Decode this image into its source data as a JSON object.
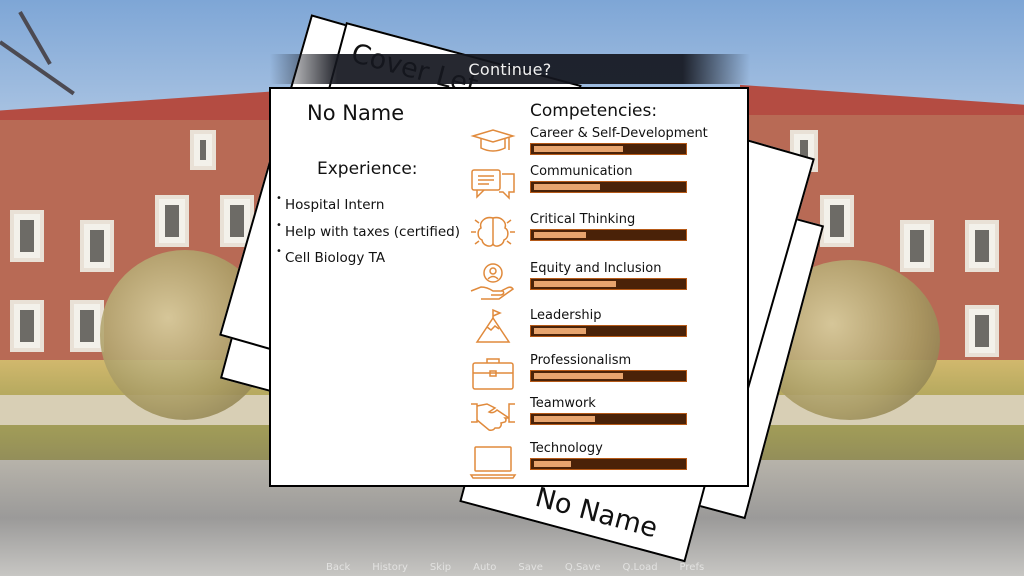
{
  "banner": {
    "continue_label": "Continue?"
  },
  "papers": {
    "cover_letter_title": "Cover Let",
    "bottom_name": "No Name"
  },
  "resume": {
    "name": "No Name",
    "experience_title": "Experience:",
    "experience": [
      "Hospital Intern",
      "Help with taxes (certified)",
      "Cell Biology TA"
    ],
    "competencies_title": "Competencies:",
    "competencies": [
      {
        "label": "Career & Self-Development",
        "icon": "graduation-cap-icon",
        "level": 0.6
      },
      {
        "label": "Communication",
        "icon": "speech-bubbles-icon",
        "level": 0.44
      },
      {
        "label": "Critical Thinking",
        "icon": "brain-icon",
        "level": 0.35
      },
      {
        "label": "Equity and Inclusion",
        "icon": "hand-holding-person-icon",
        "level": 0.55
      },
      {
        "label": "Leadership",
        "icon": "mountain-flag-icon",
        "level": 0.35
      },
      {
        "label": "Professionalism",
        "icon": "briefcase-icon",
        "level": 0.6
      },
      {
        "label": "Teamwork",
        "icon": "handshake-icon",
        "level": 0.41
      },
      {
        "label": "Technology",
        "icon": "laptop-icon",
        "level": 0.25
      }
    ]
  },
  "quick_menu": [
    "Back",
    "History",
    "Skip",
    "Auto",
    "Save",
    "Q.Save",
    "Q.Load",
    "Prefs"
  ],
  "colors": {
    "accent": "#e08a3c",
    "bar_track": "#4a2208",
    "bar_fill": "#e7a46e",
    "banner": "#14161e"
  }
}
